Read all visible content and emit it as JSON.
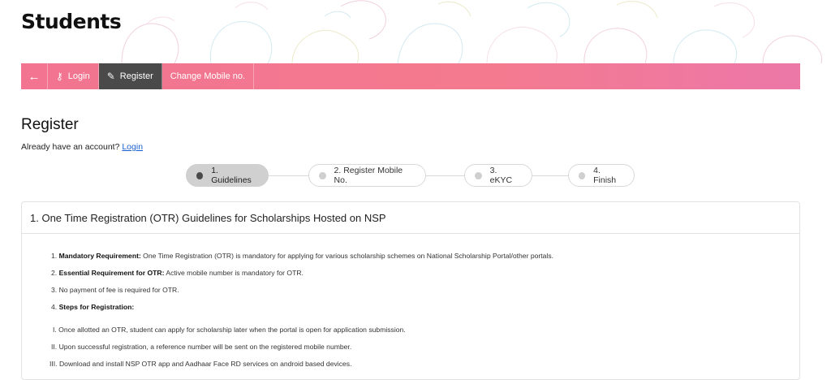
{
  "header": {
    "title": "Students"
  },
  "nav": {
    "back_icon": "arrow-left-icon",
    "items": [
      {
        "label": "Login",
        "icon": "key-icon",
        "active": false
      },
      {
        "label": "Register",
        "icon": "edit-icon",
        "active": true
      },
      {
        "label": "Change Mobile no.",
        "active": false
      }
    ]
  },
  "register": {
    "title": "Register",
    "have_account_text": "Already have an account?",
    "login_link": "Login"
  },
  "stepper": {
    "steps": [
      {
        "label": "1. Guidelines",
        "active": true
      },
      {
        "label": "2. Register Mobile No.",
        "active": false
      },
      {
        "label": "3. eKYC",
        "active": false
      },
      {
        "label": "4. Finish",
        "active": false
      }
    ]
  },
  "guidelines": {
    "title": "1. One Time Registration (OTR) Guidelines for Scholarships Hosted on NSP",
    "items": [
      {
        "num": "1.",
        "bold": "Mandatory Requirement:",
        "text": " One Time Registration (OTR) is mandatory for applying for various scholarship schemes on National Scholarship Portal/other portals."
      },
      {
        "num": "2.",
        "bold": "Essential Requirement for OTR:",
        "text": " Active mobile number is mandatory for OTR."
      },
      {
        "num": "3.",
        "bold": "",
        "text": "No payment of fee is required for OTR."
      },
      {
        "num": "4.",
        "bold": "Steps for Registration:",
        "text": ""
      }
    ],
    "steps": [
      {
        "num": "I.",
        "text": "Once allotted an OTR, student can apply for scholarship later when the portal is open for application submission."
      },
      {
        "num": "II.",
        "text": "Upon successful registration, a reference number will be sent on the registered mobile number."
      },
      {
        "num": "III.",
        "text": "Download and install NSP OTR app and Aadhaar Face RD services on android based devices."
      }
    ]
  },
  "colors": {
    "nav_start": "#f27490",
    "nav_end": "#ec78a8",
    "active_tab": "#4a4a4a",
    "link": "#1a5fd1"
  }
}
